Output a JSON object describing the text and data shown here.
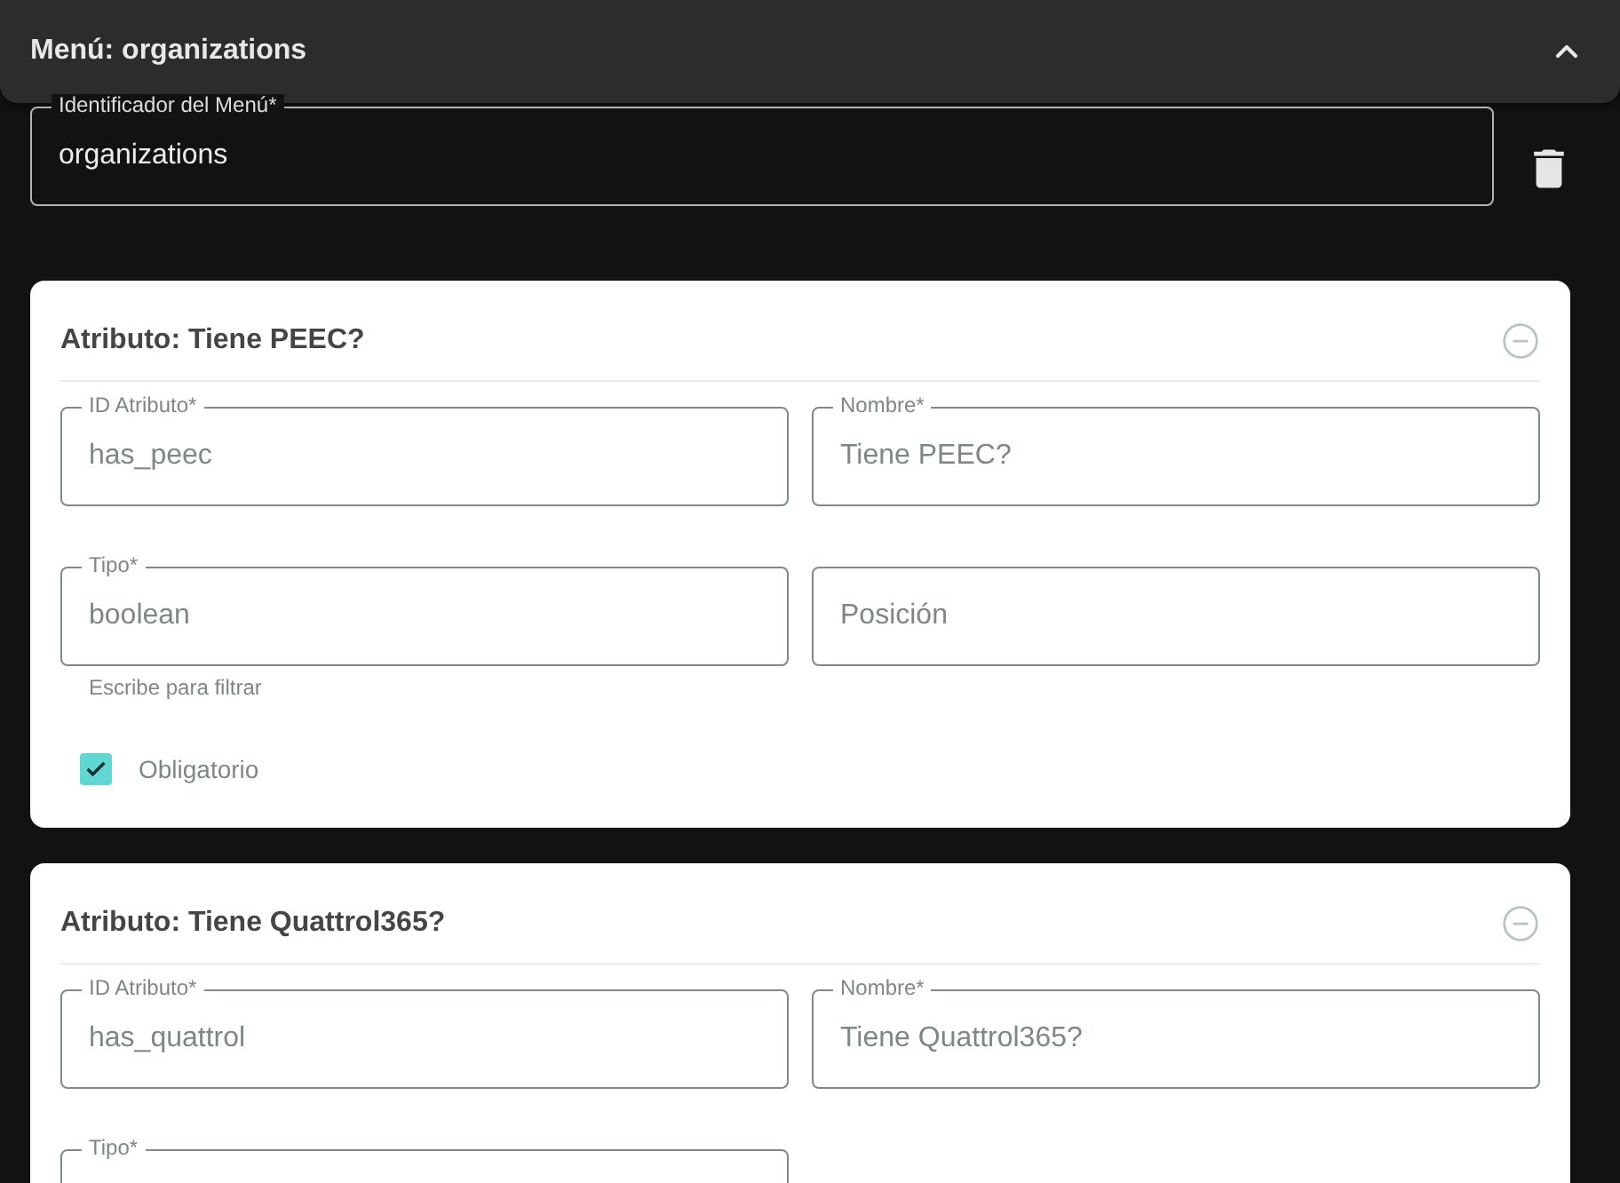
{
  "menu": {
    "title": "Menú: organizations",
    "expanded": true,
    "id_field": {
      "label": "Identificador del Menú*",
      "value": "organizations"
    }
  },
  "attributes": [
    {
      "title": "Atributo: Tiene PEEC?",
      "fields": [
        {
          "label": "ID Atributo*",
          "value": "has_peec"
        },
        {
          "label": "Nombre*",
          "value": "Tiene PEEC?"
        },
        {
          "label": "Tipo*",
          "value": "boolean",
          "helper": "Escribe para filtrar"
        },
        {
          "placeholder": "Posición"
        }
      ],
      "required": {
        "label": "Obligatorio",
        "checked": true
      }
    },
    {
      "title": "Atributo: Tiene Quattrol365?",
      "fields": [
        {
          "label": "ID Atributo*",
          "value": "has_quattrol"
        },
        {
          "label": "Nombre*",
          "value": "Tiene Quattrol365?"
        },
        {
          "label": "Tipo*"
        }
      ]
    }
  ]
}
